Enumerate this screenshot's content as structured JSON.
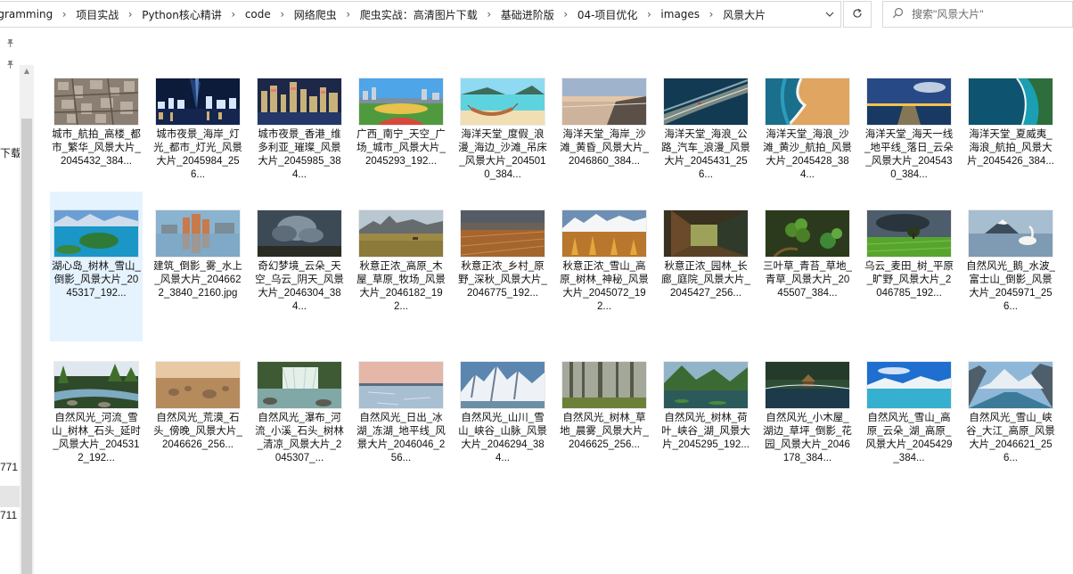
{
  "address_bar": {
    "crumbs": [
      "ogramming",
      "项目实战",
      "Python核心精讲",
      "code",
      "网络爬虫",
      "爬虫实战：高清图片下载",
      "基础进阶版",
      "04-项目优化",
      "images",
      "风景大片"
    ],
    "separator": "›",
    "dropdown_icon": "chevron-down-icon",
    "refresh_icon": "refresh-icon"
  },
  "search": {
    "placeholder": "搜索\"风景大片\"",
    "icon": "search-icon"
  },
  "nav_pane": {
    "labels": [
      "下载",
      "771",
      "711"
    ]
  },
  "files": [
    {
      "name": "城市_航拍_高楼_都市_繁华_风景大片_2045432_384...",
      "theme": "city-aerial"
    },
    {
      "name": "城市夜景_海岸_灯光_都市_灯光_风景大片_2045984_256...",
      "theme": "city-night"
    },
    {
      "name": "城市夜景_香港_维多利亚_璀璨_风景大片_2045985_384...",
      "theme": "hk-night"
    },
    {
      "name": "广西_南宁_天空_广场_城市_风景大片_2045293_192...",
      "theme": "plaza"
    },
    {
      "name": "海洋天堂_度假_浪漫_海边_沙滩_吊床_风景大片_2045010_384...",
      "theme": "hammock"
    },
    {
      "name": "海洋天堂_海岸_沙滩_黄昏_风景大片_2046860_384...",
      "theme": "dusk-beach"
    },
    {
      "name": "海洋天堂_海浪_公路_汽车_浪漫_风景大片_2045431_256...",
      "theme": "coast-road"
    },
    {
      "name": "海洋天堂_海浪_沙滩_黄沙_航拍_风景大片_2045428_384...",
      "theme": "wave-sand"
    },
    {
      "name": "海洋天堂_海天一线_地平线_落日_云朵_风景大片_2045430_384...",
      "theme": "sea-sunset"
    },
    {
      "name": "海洋天堂_夏威夷_海浪_航拍_风景大片_2045426_384...",
      "theme": "hawaii"
    },
    {
      "name": "湖心岛_树林_雪山_倒影_风景大片_2045317_192...",
      "theme": "lake-island",
      "selected": true
    },
    {
      "name": "建筑_倒影_雾_水上_风景大片_2046622_3840_2160.jpg",
      "theme": "building-reflect"
    },
    {
      "name": "奇幻梦境_云朵_天空_乌云_阴天_风景大片_2046304_384...",
      "theme": "dark-clouds"
    },
    {
      "name": "秋意正浓_高原_木屋_草原_牧场_风景大片_2046182_192...",
      "theme": "autumn-ranch"
    },
    {
      "name": "秋意正浓_乡村_原野_深秋_风景大片_2046775_192...",
      "theme": "autumn-field"
    },
    {
      "name": "秋意正浓_雪山_高原_树林_神秘_风景大片_2045072_192...",
      "theme": "snow-autumn"
    },
    {
      "name": "秋意正浓_园林_长廊_庭院_风景大片_2045427_256...",
      "theme": "corridor"
    },
    {
      "name": "三叶草_青苔_草地_青草_风景大片_2045507_384...",
      "theme": "clover"
    },
    {
      "name": "乌云_麦田_树_平原_旷野_风景大片_2046785_192...",
      "theme": "wheat-tree"
    },
    {
      "name": "自然风光_鹅_水波_富士山_倒影_风景大片_2045971_256...",
      "theme": "fuji-swan"
    },
    {
      "name": "自然风光_河流_雪山_树林_石头_延时_风景大片_2045312_192...",
      "theme": "river-forest"
    },
    {
      "name": "自然风光_荒漠_石头_傍晚_风景大片_2046626_256...",
      "theme": "desert-rocks"
    },
    {
      "name": "自然风光_瀑布_河流_小溪_石头_树林_清凉_风景大片_2045307_...",
      "theme": "waterfall"
    },
    {
      "name": "自然风光_日出_冰湖_冻湖_地平线_风景大片_2046046_256...",
      "theme": "ice-lake"
    },
    {
      "name": "自然风光_山川_雪山_峡谷_山脉_风景大片_2046294_384...",
      "theme": "snow-peaks"
    },
    {
      "name": "自然风光_树林_草地_晨雾_风景大片_2046625_256...",
      "theme": "misty-forest"
    },
    {
      "name": "自然风光_树林_荷叶_峡谷_湖_风景大片_2045295_192...",
      "theme": "valley-lake"
    },
    {
      "name": "自然风光_小木屋_湖边_草坪_倒影_花园_风景大片_2046178_384...",
      "theme": "cabin-lake"
    },
    {
      "name": "自然风光_雪山_高原_云朵_湖_高原_风景大片_2045429_384...",
      "theme": "highland-lake"
    },
    {
      "name": "自然风光_雪山_峡谷_大江_高原_风景大片_2046621_256...",
      "theme": "canyon-river"
    }
  ]
}
